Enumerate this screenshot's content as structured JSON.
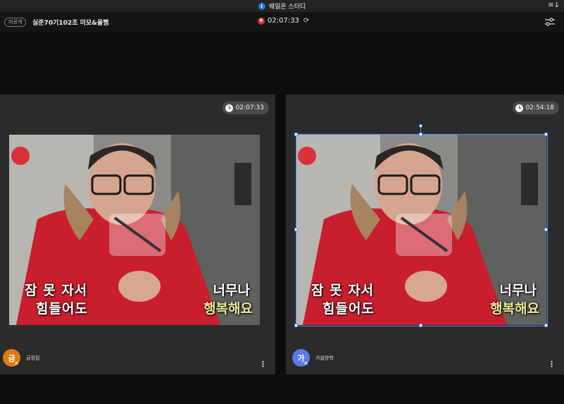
{
  "window": {
    "title": "웨일온 스터디",
    "info_glyph": "i",
    "sort_glyph": "≡↓"
  },
  "header": {
    "visibility_badge": "비공개",
    "room_title": "실준70기102조 미모&올삠",
    "rec_glyph": "R",
    "elapsed": "02:07:33",
    "refresh_glyph": "⟳"
  },
  "participants": [
    {
      "timer": "02:07:33",
      "name": "금정킴",
      "avatar_letter": "금",
      "avatar_color": "#e07b12",
      "caption_left_1": "잠 못 자서",
      "caption_left_2": "힘들어도",
      "caption_right_1": "너무나",
      "caption_right_2": "행복해요",
      "selected": false
    },
    {
      "timer": "02:54:18",
      "name": "가을방학",
      "avatar_letter": "가",
      "avatar_color": "#5b7be6",
      "caption_left_1": "잠 못 자서",
      "caption_left_2": "힘들어도",
      "caption_right_1": "너무나",
      "caption_right_2": "행복해요",
      "selected": true
    }
  ],
  "icons": {
    "clock": "clock-icon",
    "mic_off": "mic-off-icon",
    "more": "more-vertical-icon",
    "settings": "sliders-icon"
  },
  "colors": {
    "accent": "#4d8df0",
    "record": "#d9302c",
    "panel": "#2b2b2b"
  }
}
